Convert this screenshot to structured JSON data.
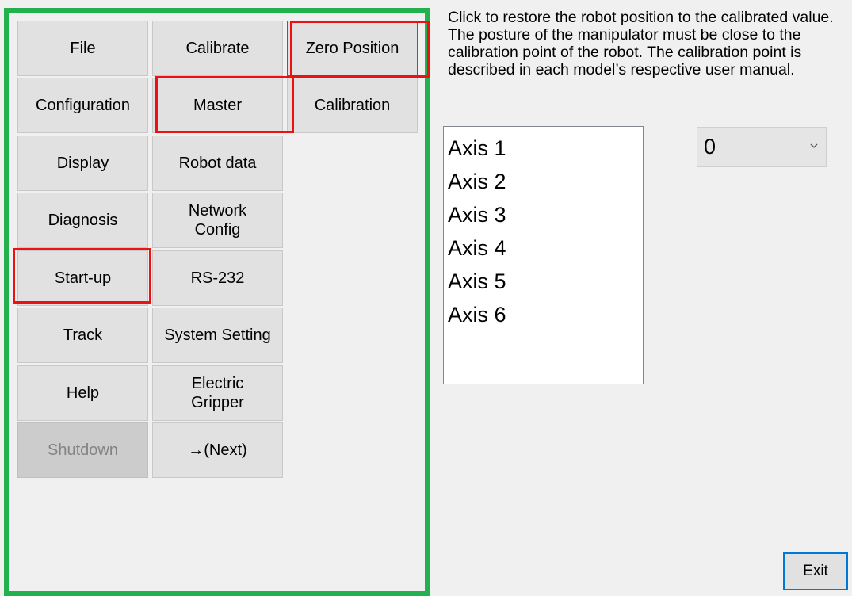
{
  "menu": {
    "file": "File",
    "calibrate": "Calibrate",
    "zero_position": "Zero Position",
    "configuration": "Configuration",
    "master": "Master",
    "calibration": "Calibration",
    "display": "Display",
    "robot_data": "Robot data",
    "diagnosis": "Diagnosis",
    "network_config_line1": "Network",
    "network_config_line2": "Config",
    "startup": "Start-up",
    "rs232": "RS-232",
    "track": "Track",
    "system_setting": "System Setting",
    "help": "Help",
    "electric_gripper_line1": "Electric",
    "electric_gripper_line2": "Gripper",
    "shutdown": "Shutdown",
    "next": "→(Next)"
  },
  "description": "Click to restore the robot position to the calibrated value. The posture of the manipulator must be close to the calibration point of the robot. The calibration point is described in each model’s respective user manual.",
  "axis_list": [
    "Axis 1",
    "Axis 2",
    "Axis 3",
    "Axis 4",
    "Axis 5",
    "Axis 6"
  ],
  "combo": {
    "selected": "0"
  },
  "exit_label": "Exit",
  "colors": {
    "frame": "#22b14c",
    "highlight": "#ee1111",
    "focus": "#0078d7"
  }
}
